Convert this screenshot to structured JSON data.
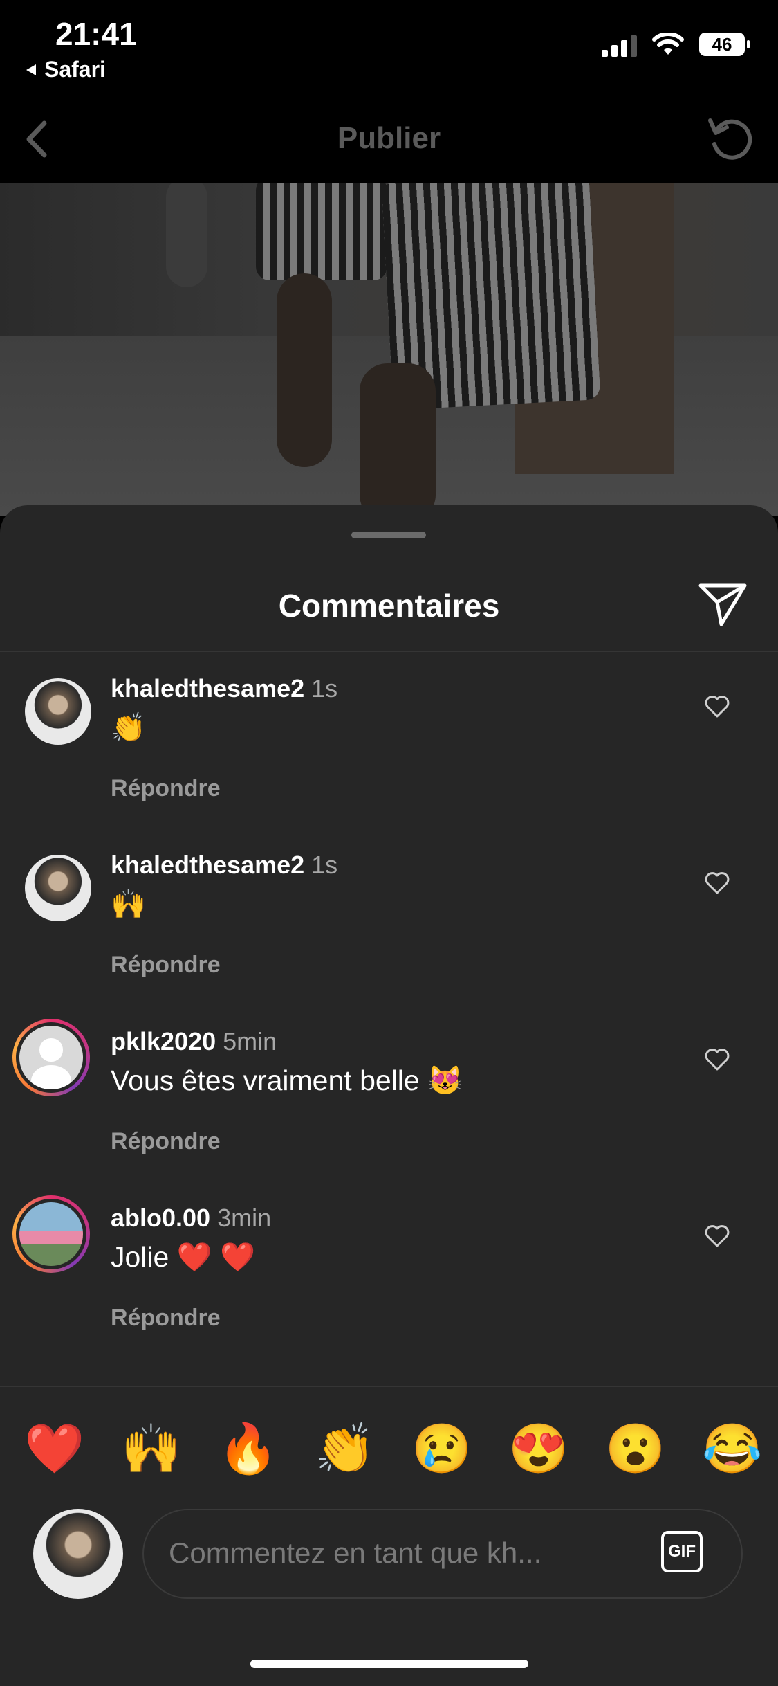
{
  "status": {
    "time": "21:41",
    "back_app": "Safari",
    "battery": "46"
  },
  "nav": {
    "title": "Publier"
  },
  "sheet": {
    "title": "Commentaires"
  },
  "comments": [
    {
      "username": "khaledthesame2",
      "time": "1s",
      "text": "👏",
      "reply": "Répondre"
    },
    {
      "username": "khaledthesame2",
      "time": "1s",
      "text": "🙌",
      "reply": "Répondre"
    },
    {
      "username": "pklk2020",
      "time": "5min",
      "text": "Vous êtes vraiment belle 😻",
      "reply": "Répondre"
    },
    {
      "username": "ablo0.00",
      "time": "3min",
      "text": "Jolie ❤️ ❤️",
      "reply": "Répondre"
    }
  ],
  "emojis": [
    "❤️",
    "🙌",
    "🔥",
    "👏",
    "😢",
    "😍",
    "😮",
    "😂"
  ],
  "composer": {
    "placeholder": "Commentez en tant que kh...",
    "gif_label": "GIF"
  }
}
